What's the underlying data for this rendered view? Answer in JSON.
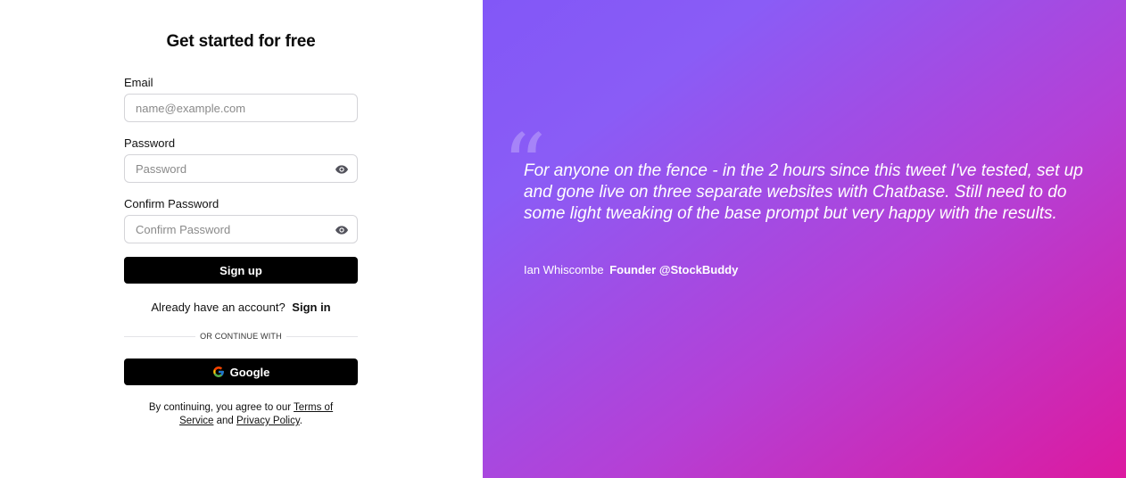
{
  "form": {
    "title": "Get started for free",
    "email_label": "Email",
    "email_placeholder": "name@example.com",
    "password_label": "Password",
    "password_placeholder": "Password",
    "confirm_label": "Confirm Password",
    "confirm_placeholder": "Confirm Password",
    "signup_button": "Sign up",
    "have_account_text": "Already have an account?",
    "signin_link": "Sign in",
    "divider_text": "OR CONTINUE WITH",
    "google_button": "Google",
    "terms_prefix": "By continuing, you agree to our",
    "terms_link": "Terms of Service",
    "terms_and": "and",
    "privacy_link": "Privacy Policy",
    "terms_suffix": "."
  },
  "testimonial": {
    "quote": "For anyone on the fence - in the 2 hours since this tweet I've tested, set up and gone live on three separate websites with Chatbase. Still need to do some light tweaking of the base prompt but very happy with the results.",
    "author_name": "Ian Whiscombe",
    "author_title": "Founder @StockBuddy"
  },
  "colors": {
    "gradient_start": "#8257f7",
    "gradient_end": "#dc1aa0",
    "button_bg": "#000000"
  },
  "icons": {
    "password_toggle": "eye-icon",
    "google": "google-icon"
  }
}
